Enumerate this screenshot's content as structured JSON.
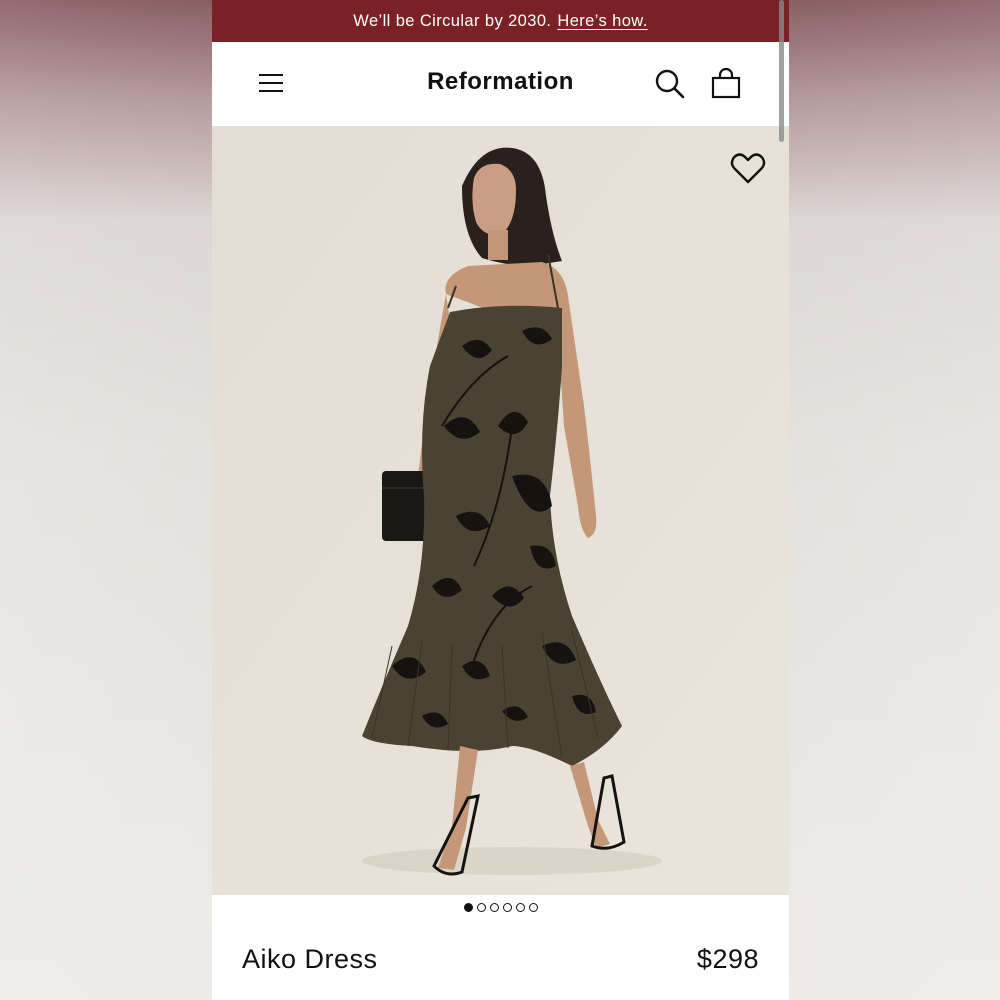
{
  "promo": {
    "text": "We’ll be Circular by 2030.",
    "link": "Here’s how."
  },
  "header": {
    "brand": "Reformation",
    "menu_icon": "hamburger-menu-icon",
    "search_icon": "search-icon",
    "bag_icon": "shopping-bag-icon"
  },
  "gallery": {
    "wishlist_icon": "heart-icon",
    "image_count": 6,
    "active_index": 0
  },
  "product": {
    "name": "Aiko Dress",
    "price": "$298"
  },
  "colors": {
    "promo_bar": "#7a2126",
    "hero_background": "#e4e0d6",
    "dress": "#4a4233",
    "text": "#111111"
  }
}
